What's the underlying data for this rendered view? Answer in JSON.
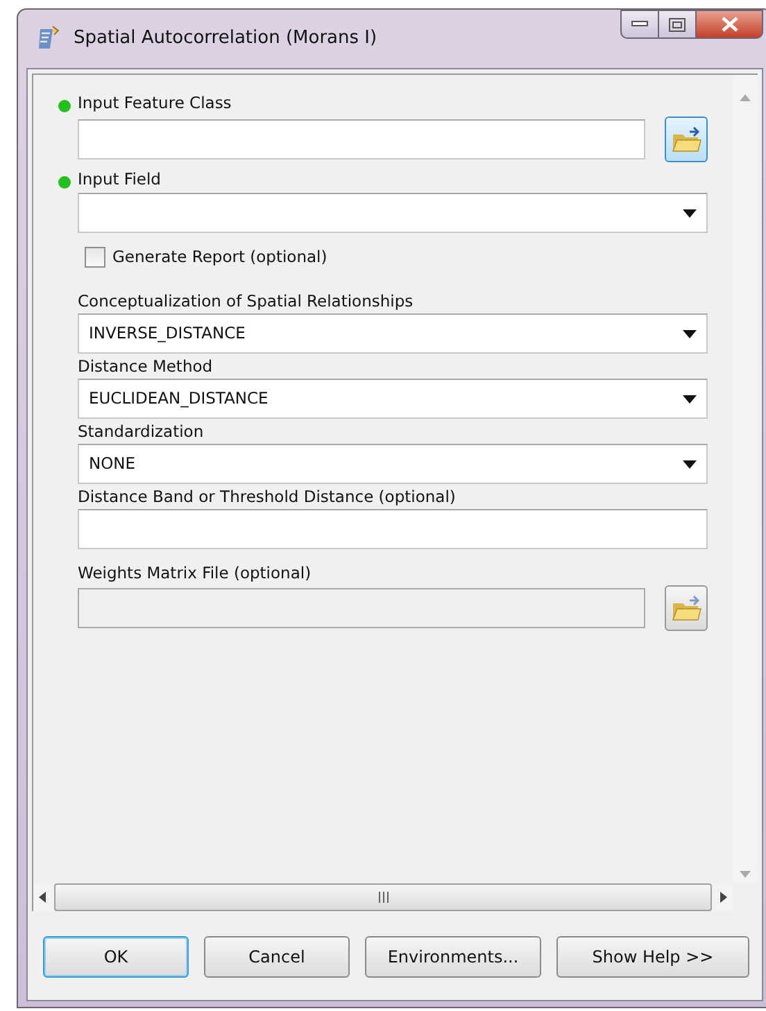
{
  "window": {
    "title": "Spatial Autocorrelation (Morans I)"
  },
  "parameters": [
    {
      "kind": "file",
      "label": "Input Feature Class",
      "required": true,
      "disabled": false
    },
    {
      "kind": "dropdown",
      "label": "Input Field",
      "required": true
    },
    {
      "kind": "checkbox",
      "label": "Generate Report (optional)",
      "checked": false
    },
    {
      "kind": "dropdown",
      "label": "Conceptualization of Spatial Relationships",
      "required": false,
      "value": "INVERSE_DISTANCE"
    },
    {
      "kind": "dropdown",
      "label": "Distance Method",
      "required": false,
      "value": "EUCLIDEAN_DISTANCE"
    },
    {
      "kind": "dropdown",
      "label": "Standardization",
      "required": false,
      "value": "NONE"
    },
    {
      "kind": "text",
      "label": "Distance Band or Threshold Distance (optional)",
      "required": false
    },
    {
      "kind": "file",
      "label": "Weights Matrix File (optional)",
      "required": false,
      "disabled": true
    }
  ],
  "buttons": [
    {
      "label": "OK",
      "default": true
    },
    {
      "label": "Cancel",
      "default": false
    },
    {
      "label": "Environments...",
      "default": false
    },
    {
      "label": "Show Help >>",
      "default": false
    }
  ]
}
